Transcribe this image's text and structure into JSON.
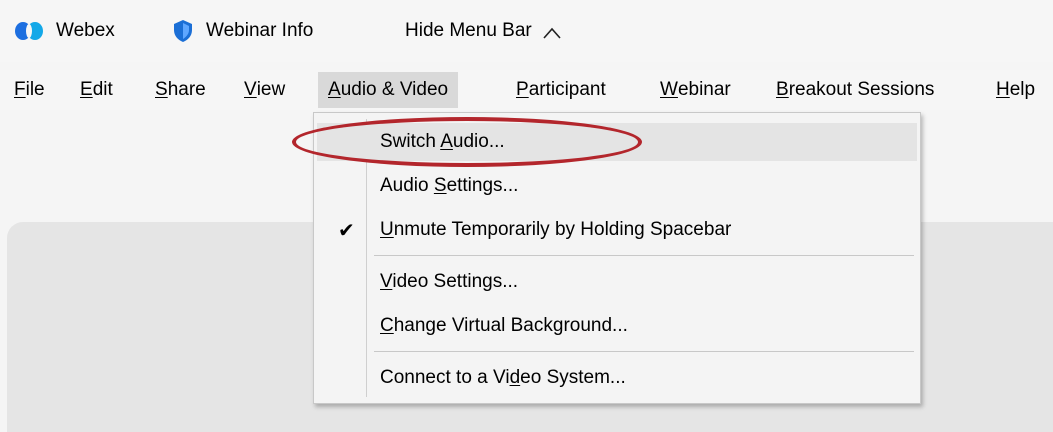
{
  "titlebar": {
    "app_name": "Webex",
    "webinar_info": "Webinar Info",
    "hide_menu_bar": "Hide Menu Bar",
    "hide_chevron": "^"
  },
  "menubar": {
    "items": [
      {
        "label": "File",
        "u": "F",
        "rest": "ile"
      },
      {
        "label": "Edit",
        "u": "E",
        "rest": "dit"
      },
      {
        "label": "Share",
        "u": "S",
        "rest": "hare"
      },
      {
        "label": "View",
        "u": "V",
        "rest": "iew"
      },
      {
        "label": "Audio & Video",
        "u": "A",
        "rest": "udio & Video"
      },
      {
        "label": "Participant",
        "u": "P",
        "rest": "articipant"
      },
      {
        "label": "Webinar",
        "u": "W",
        "rest": "ebinar"
      },
      {
        "label": "Breakout Sessions",
        "u": "B",
        "rest": "reakout Sessions"
      },
      {
        "label": "Help",
        "u": "H",
        "rest": "elp"
      }
    ]
  },
  "dropdown": {
    "items": [
      {
        "pre": "Switch ",
        "u": "A",
        "post": "udio...",
        "checked": false
      },
      {
        "pre": "Audio ",
        "u": "S",
        "post": "ettings...",
        "checked": false
      },
      {
        "pre": "",
        "u": "U",
        "post": "nmute Temporarily by Holding Spacebar",
        "checked": true
      },
      {
        "pre": "",
        "u": "V",
        "post": "ideo Settings...",
        "checked": false
      },
      {
        "pre": "",
        "u": "C",
        "post": "hange Virtual Background...",
        "checked": false
      },
      {
        "pre": "Connect to a Vi",
        "u": "d",
        "post": "eo System...",
        "checked": false
      }
    ],
    "check_glyph": "✔"
  },
  "colors": {
    "annotation": "#b3262c",
    "menu_highlight": "#d9d9d9",
    "webex_blue": "#1d6fe0"
  }
}
